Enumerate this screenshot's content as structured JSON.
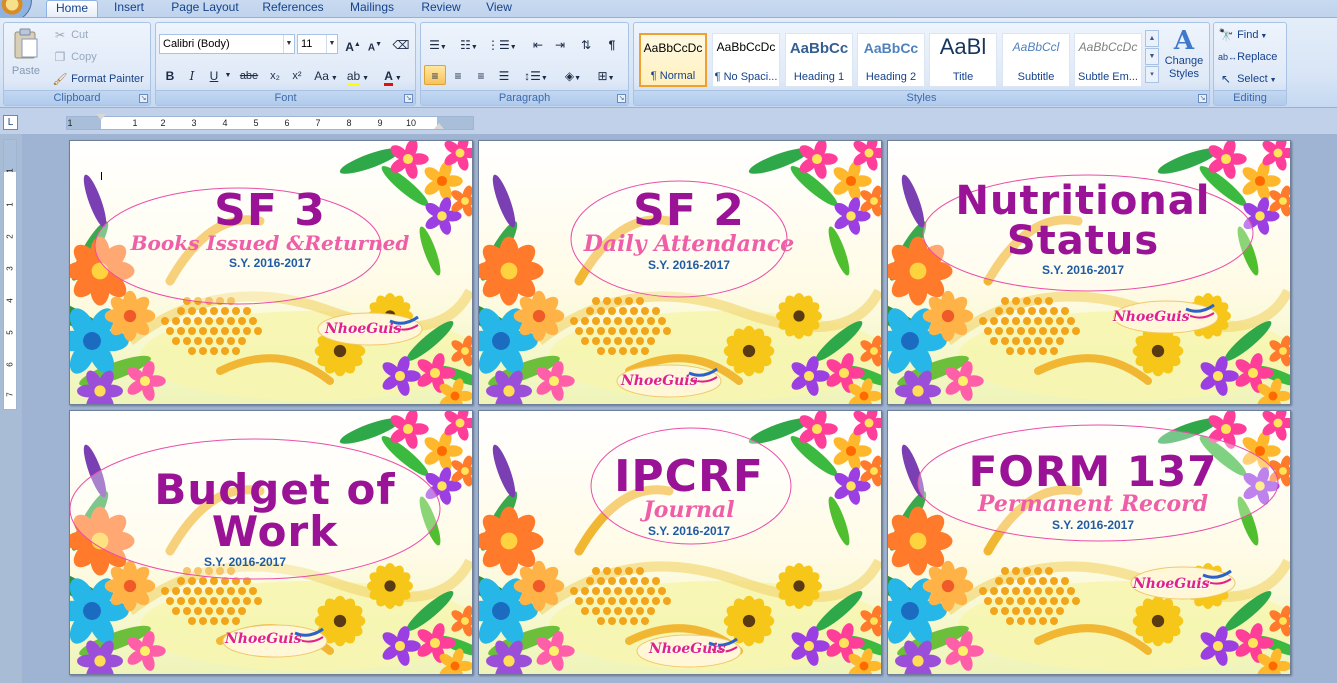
{
  "tabs": [
    {
      "label": "Home",
      "active": true
    },
    {
      "label": "Insert"
    },
    {
      "label": "Page Layout"
    },
    {
      "label": "References"
    },
    {
      "label": "Mailings"
    },
    {
      "label": "Review"
    },
    {
      "label": "View"
    }
  ],
  "clipboard": {
    "group_label": "Clipboard",
    "paste": "Paste",
    "cut": "Cut",
    "copy": "Copy",
    "format_painter": "Format Painter"
  },
  "font": {
    "group_label": "Font",
    "family": "Calibri (Body)",
    "size": "11",
    "bold": "B",
    "italic": "I",
    "underline": "U",
    "strike": "abe",
    "subscript": "x₂",
    "superscript": "x²",
    "change_case": "Aa",
    "grow": "A",
    "shrink": "A",
    "font_color": "A"
  },
  "paragraph": {
    "group_label": "Paragraph"
  },
  "styles": {
    "group_label": "Styles",
    "items": [
      {
        "sample": "AaBbCcDc",
        "name": "¶ Normal",
        "selected": true
      },
      {
        "sample": "AaBbCcDc",
        "name": "¶ No Spaci..."
      },
      {
        "sample": "AaBbCc",
        "name": "Heading 1"
      },
      {
        "sample": "AaBbCc",
        "name": "Heading 2"
      },
      {
        "sample": "AaBl",
        "name": "Title"
      },
      {
        "sample": "AaBbCcl",
        "name": "Subtitle"
      },
      {
        "sample": "AaBbCcDc",
        "name": "Subtle Em..."
      }
    ],
    "change_styles": "Change Styles"
  },
  "editing": {
    "group_label": "Editing",
    "find": "Find",
    "replace": "Replace",
    "select": "Select"
  },
  "ruler": {
    "h_numbers": [
      "1",
      "1",
      "2",
      "3",
      "4",
      "5",
      "6",
      "7",
      "8",
      "9",
      "10"
    ],
    "v_numbers": [
      "1",
      "1",
      "2",
      "3",
      "4",
      "5",
      "6",
      "7"
    ]
  },
  "cards": [
    {
      "title": "SF 3",
      "subtitle": "Books Issued &Returned",
      "sy": "S.Y. 2016-2017",
      "logo": "NhoeGuis"
    },
    {
      "title": "SF 2",
      "subtitle": "Daily Attendance",
      "sy": "S.Y. 2016-2017",
      "logo": "NhoeGuis"
    },
    {
      "title": "Nutritional Status",
      "title_line1": "Nutritional",
      "title_line2": "Status",
      "subtitle": "",
      "sy": "S.Y. 2016-2017",
      "logo": "NhoeGuis"
    },
    {
      "title": "Budget of Work",
      "title_line1": "Budget of",
      "title_line2": "Work",
      "subtitle": "",
      "sy": "S.Y. 2016-2017",
      "logo": "NhoeGuis"
    },
    {
      "title": "IPCRF",
      "subtitle": "Journal",
      "sy": "S.Y. 2016-2017",
      "logo": "NhoeGuis"
    },
    {
      "title": "FORM 137",
      "subtitle": "Permanent Record",
      "sy": "S.Y. 2016-2017",
      "logo": "NhoeGuis"
    }
  ]
}
